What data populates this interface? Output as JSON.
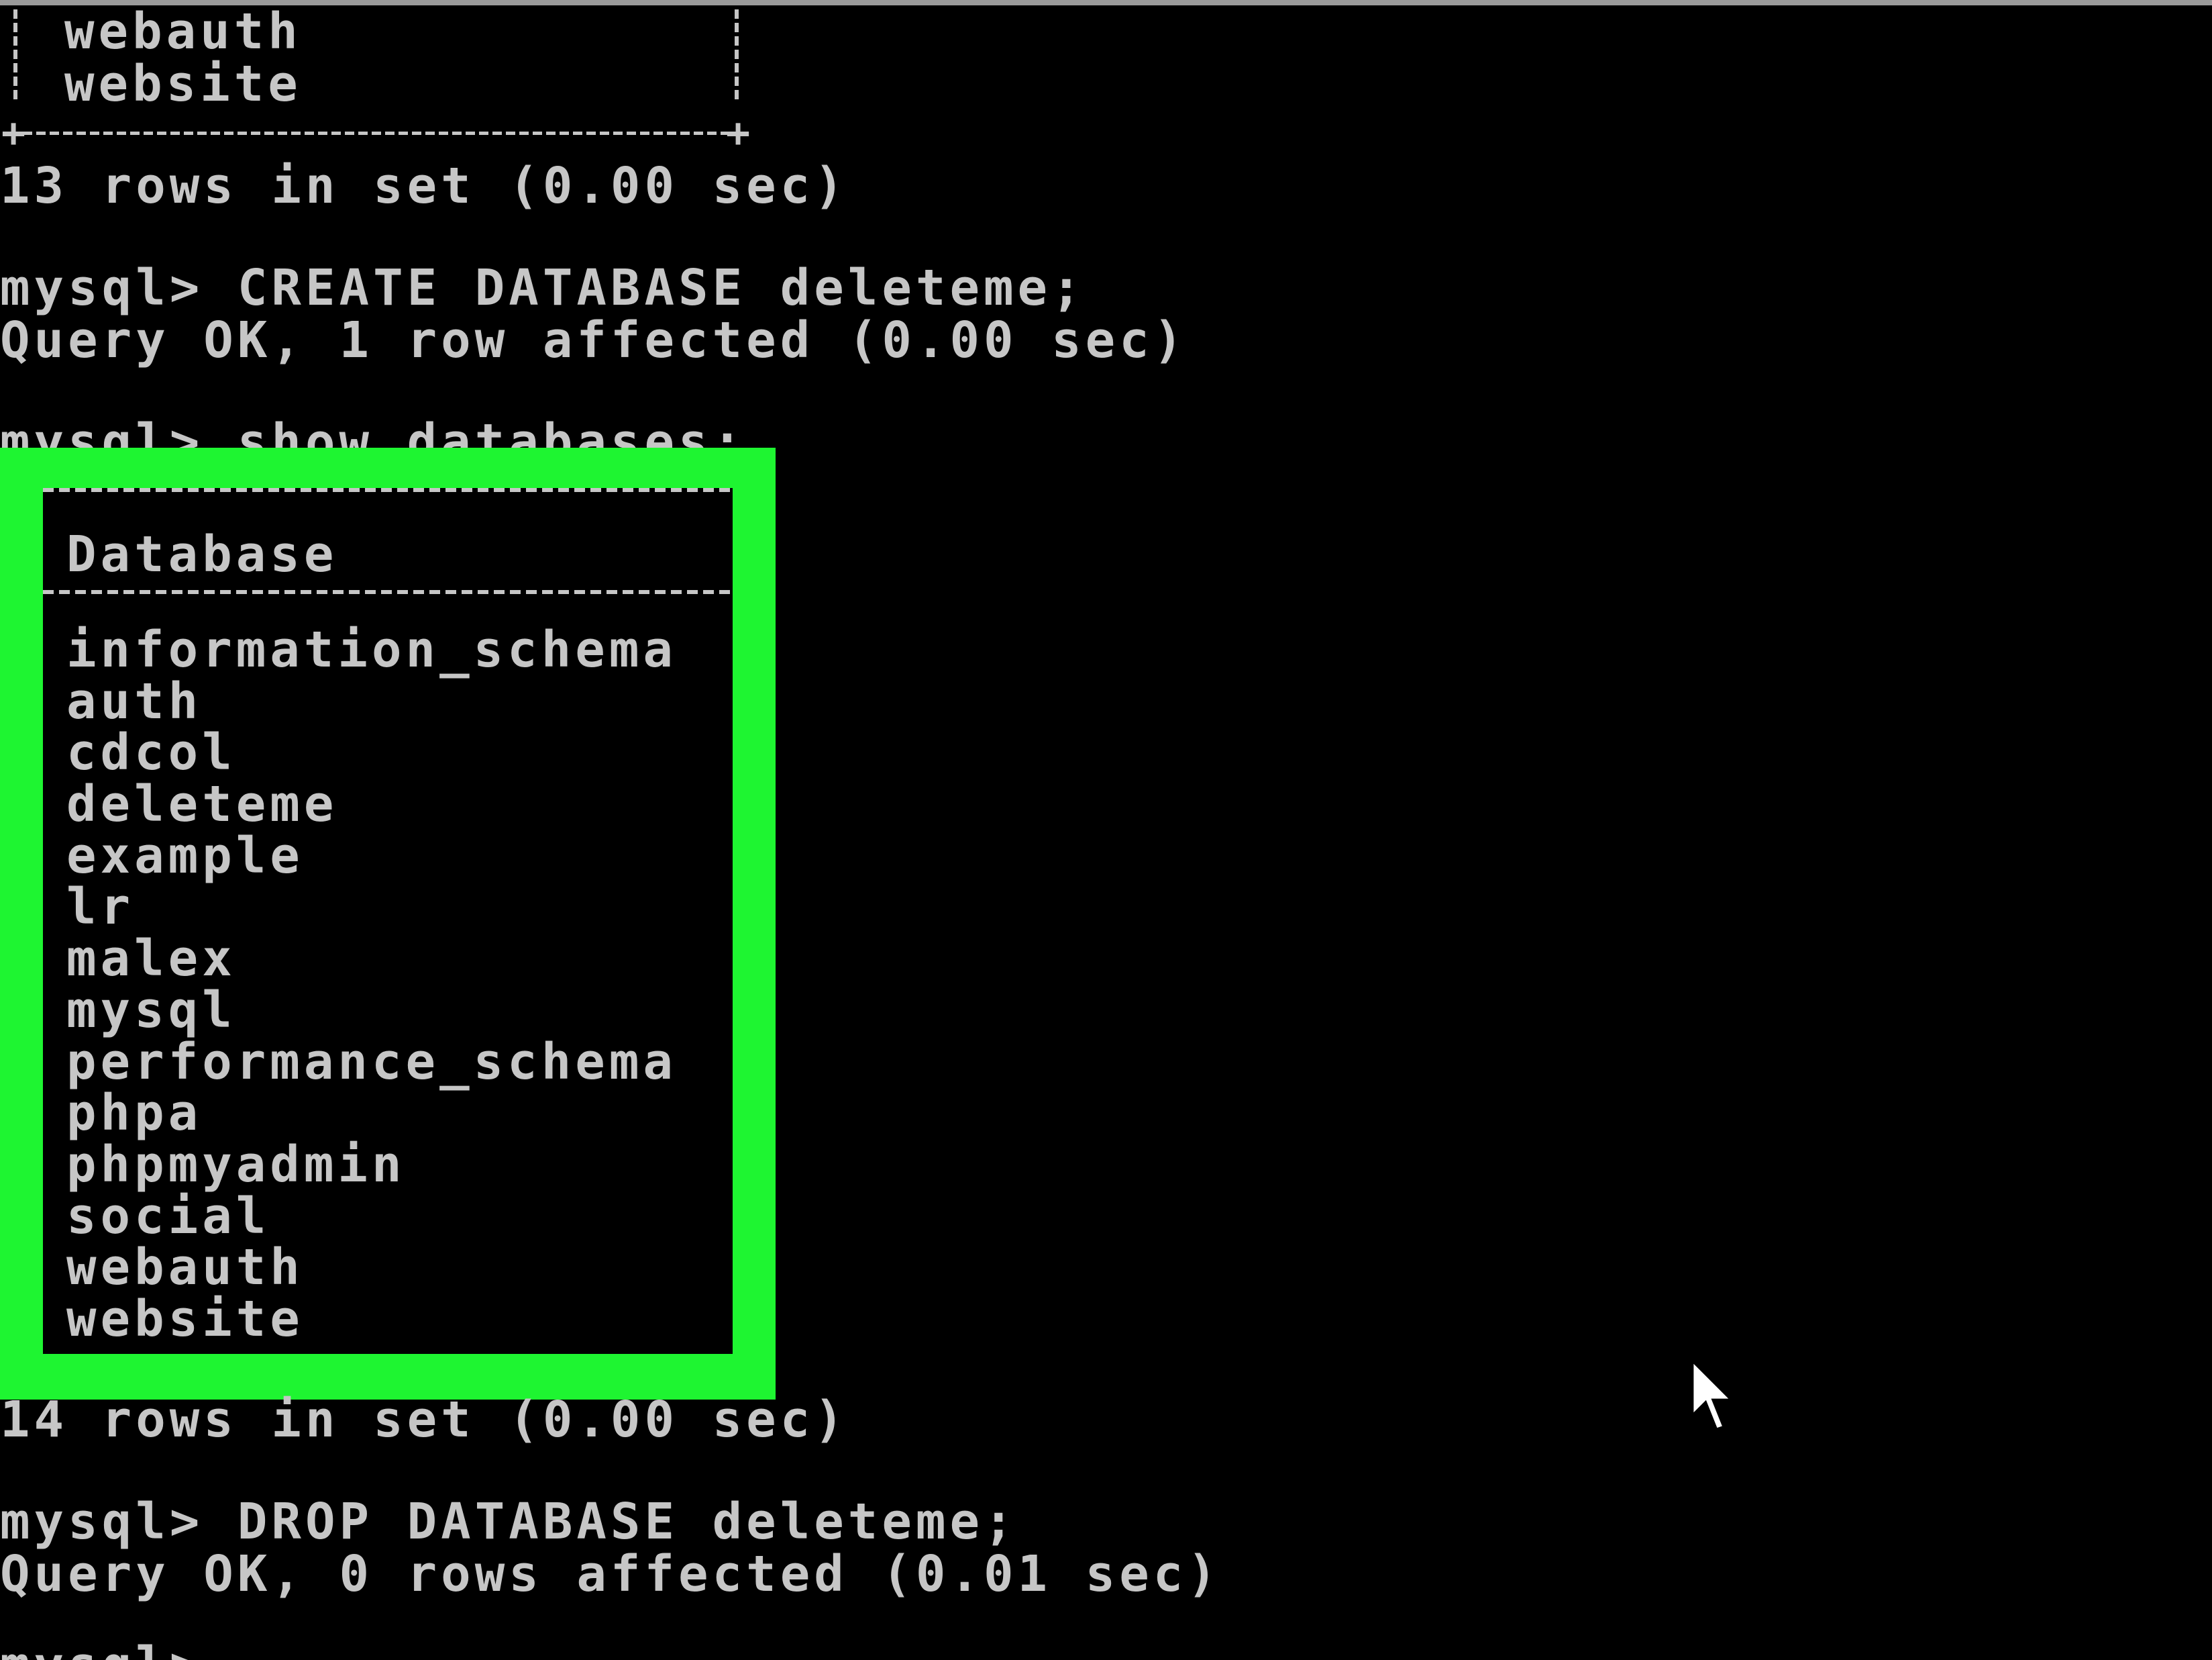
{
  "terminal": {
    "background": "#000000",
    "text_color": "#c6c6c6",
    "top_table_rows": [
      "webauth",
      "website"
    ],
    "top_table_bottom": "+--------------------+",
    "lines": [
      "13 rows in set (0.00 sec)",
      "mysql> CREATE DATABASE deleteme;",
      "Query OK, 1 row affected (0.00 sec)",
      "mysql> show databases;",
      "14 rows in set (0.00 sec)",
      "mysql> DROP DATABASE deleteme;",
      "Query OK, 0 rows affected (0.01 sec)",
      "mysql>"
    ]
  },
  "highlight": {
    "color": "#1ef531",
    "table_header": "Database",
    "databases": [
      "information_schema",
      "auth",
      "cdcol",
      "deleteme",
      "example",
      "lr",
      "malex",
      "mysql",
      "performance_schema",
      "phpa",
      "phpmyadmin",
      "social",
      "webauth",
      "website"
    ]
  },
  "cursor": {
    "icon": "mouse-pointer-icon"
  }
}
